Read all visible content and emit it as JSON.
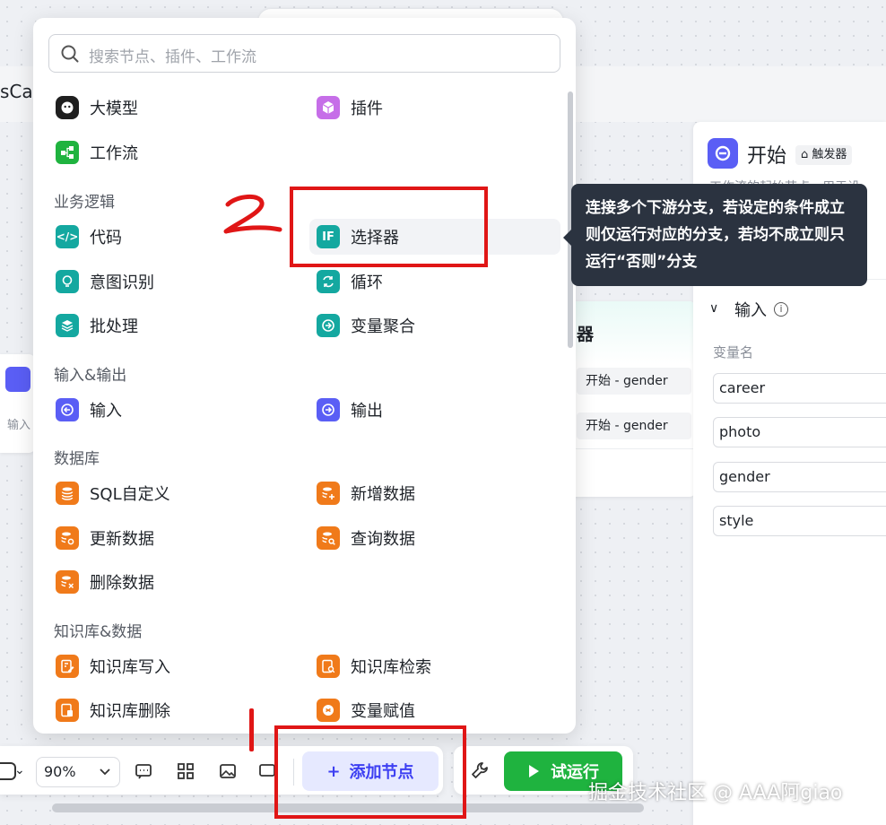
{
  "background": {
    "left_tab_title": "sCar",
    "left_node_label": "输入",
    "mid_node": {
      "title": "器",
      "rows": [
        "开始  -  gender",
        "开始  -  gender"
      ]
    }
  },
  "right_panel": {
    "title": "开始",
    "badge": "触发器",
    "subtitle": "工作流的起始节点，用于设",
    "section_title": "输入",
    "variable_label": "变量名",
    "variables": [
      "career",
      "photo",
      "gender",
      "style"
    ]
  },
  "popup": {
    "search_placeholder": "搜索节点、插件、工作流",
    "top_items": [
      {
        "label": "大模型",
        "icon": "llm-icon"
      },
      {
        "label": "插件",
        "icon": "plugin-icon"
      },
      {
        "label": "工作流",
        "icon": "workflow-icon"
      }
    ],
    "groups": [
      {
        "title": "业务逻辑",
        "items": [
          {
            "label": "代码",
            "icon": "code-icon"
          },
          {
            "label": "选择器",
            "icon": "if-icon"
          },
          {
            "label": "意图识别",
            "icon": "intent-icon"
          },
          {
            "label": "循环",
            "icon": "loop-icon"
          },
          {
            "label": "批处理",
            "icon": "batch-icon"
          },
          {
            "label": "变量聚合",
            "icon": "variable-merge-icon"
          }
        ]
      },
      {
        "title": "输入&输出",
        "items": [
          {
            "label": "输入",
            "icon": "input-icon"
          },
          {
            "label": "输出",
            "icon": "output-icon"
          }
        ]
      },
      {
        "title": "数据库",
        "items": [
          {
            "label": "SQL自定义",
            "icon": "sql-icon"
          },
          {
            "label": "新增数据",
            "icon": "db-add-icon"
          },
          {
            "label": "更新数据",
            "icon": "db-update-icon"
          },
          {
            "label": "查询数据",
            "icon": "db-query-icon"
          },
          {
            "label": "删除数据",
            "icon": "db-delete-icon"
          }
        ]
      },
      {
        "title": "知识库&数据",
        "items": [
          {
            "label": "知识库写入",
            "icon": "kb-write-icon"
          },
          {
            "label": "知识库检索",
            "icon": "kb-search-icon"
          },
          {
            "label": "知识库删除",
            "icon": "kb-delete-icon"
          },
          {
            "label": "变量赋值",
            "icon": "variable-assign-icon"
          }
        ]
      }
    ],
    "tooltip": "连接多个下游分支，若设定的条件成立则仅运行对应的分支，若均不成立则只运行“否则”分支",
    "if_icon_text": "IF"
  },
  "toolbar": {
    "zoom": "90%",
    "add_node_label": "添加节点",
    "add_node_plus": "+",
    "run_label": "试运行"
  },
  "watermark": "掘金技术社区 @ AAA阿giao",
  "colors": {
    "accent": "#3d3ff2",
    "run_green": "#1fb33f",
    "annotation_red": "#e01616",
    "tooltip_bg": "#2b3340"
  }
}
